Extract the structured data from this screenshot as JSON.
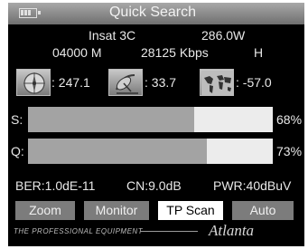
{
  "header": {
    "title": "Quick Search",
    "battery_icon": "battery-icon"
  },
  "satellite": {
    "name": "Insat 3C",
    "position": "286.0W"
  },
  "transponder": {
    "frequency": "04000 M",
    "symbol_rate": "28125 Kbps",
    "polarization": "H"
  },
  "indicators": [
    {
      "icon": "dish-compass-icon",
      "value": ": 247.1"
    },
    {
      "icon": "dish-elevation-icon",
      "value": ": 33.7"
    },
    {
      "icon": "world-map-icon",
      "value": ": -57.0"
    }
  ],
  "signal": {
    "label": "S:",
    "percent_text": "68%",
    "level": 0.68
  },
  "quality": {
    "label": "Q:",
    "percent_text": "73%",
    "level": 0.73
  },
  "status": {
    "ber": "BER:1.0dE-11",
    "cn": "CN:9.0dB",
    "pwr": "PWR:40dBuV"
  },
  "buttons": [
    {
      "label": "Zoom",
      "active": false
    },
    {
      "label": "Monitor",
      "active": false
    },
    {
      "label": "TP Scan",
      "active": true
    },
    {
      "label": "Auto",
      "active": false
    }
  ],
  "footer": {
    "tagline": "THE PROFESSIONAL EQUIPMENT",
    "brand": "Atlanta"
  },
  "colors": {
    "background": "#000000",
    "meter_fill": "#a3a3a3",
    "meter_empty": "#ececec",
    "button": "#7c7c7c",
    "button_active": "#ffffff"
  }
}
